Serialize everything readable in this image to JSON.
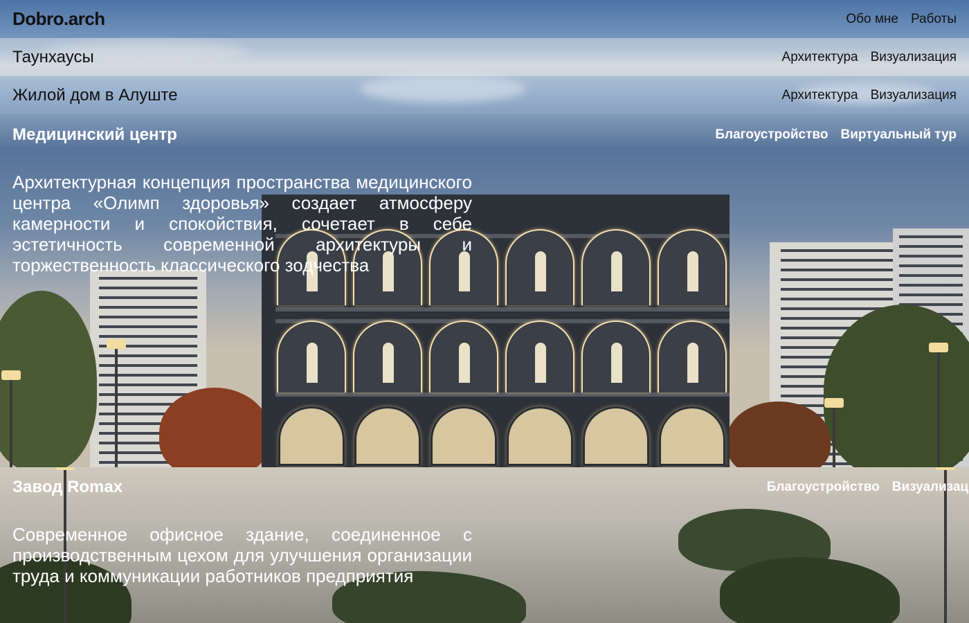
{
  "header": {
    "logo": "Dobro.arch",
    "nav": [
      "Обо мне",
      "Работы"
    ]
  },
  "projects": [
    {
      "title": "Таунхаусы",
      "tags": [
        "Архитектура",
        "Визуализация"
      ]
    },
    {
      "title": "Жилой дом в Алуште",
      "tags": [
        "Архитектура",
        "Визуализация"
      ]
    },
    {
      "title": "Медицинский центр",
      "tags": [
        "Благоустройство",
        "Виртуальный тур"
      ],
      "description": "Архитектурная концепция пространства медицинского центра «Олимп здоровья» создает атмосферу камерности и спокойствия, сочетает в себе эстетичность современной архитектуры и торжественность классического зодчества"
    },
    {
      "title": "Завод Romax",
      "tags": [
        "Благоустройство",
        "Визуализация"
      ],
      "description": "Современное офисное здание, соединенное с производственным цехом для улучшения организации труда и коммуникации работников предприятия"
    }
  ]
}
